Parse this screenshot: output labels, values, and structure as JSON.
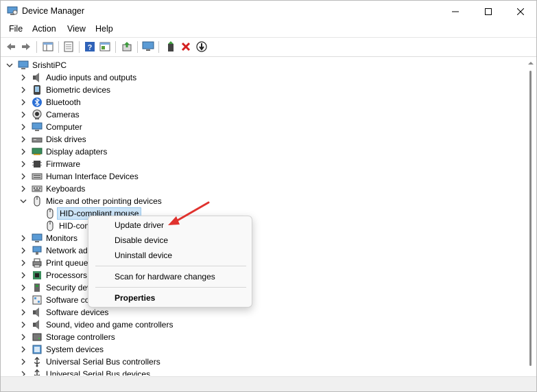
{
  "window": {
    "title": "Device Manager"
  },
  "menu": [
    "File",
    "Action",
    "View",
    "Help"
  ],
  "tree": {
    "root": "SrishtiPC",
    "categories": [
      {
        "label": "Audio inputs and outputs",
        "icon": "speaker-icon"
      },
      {
        "label": "Biometric devices",
        "icon": "fingerprint-icon"
      },
      {
        "label": "Bluetooth",
        "icon": "bluetooth-icon"
      },
      {
        "label": "Cameras",
        "icon": "camera-icon"
      },
      {
        "label": "Computer",
        "icon": "monitor-icon"
      },
      {
        "label": "Disk drives",
        "icon": "disk-drive-icon"
      },
      {
        "label": "Display adapters",
        "icon": "display-adapter-icon"
      },
      {
        "label": "Firmware",
        "icon": "chip-icon"
      },
      {
        "label": "Human Interface Devices",
        "icon": "hid-icon"
      },
      {
        "label": "Keyboards",
        "icon": "keyboard-icon"
      },
      {
        "label": "Mice and other pointing devices",
        "icon": "mouse-icon",
        "expanded": true,
        "children": [
          "HID-compliant mouse",
          "HID-con"
        ]
      },
      {
        "label": "Monitors",
        "icon": "monitor-icon"
      },
      {
        "label": "Network ad",
        "icon": "network-icon"
      },
      {
        "label": "Print queue",
        "icon": "printer-icon"
      },
      {
        "label": "Processors",
        "icon": "processor-icon"
      },
      {
        "label": "Security dev",
        "icon": "security-icon"
      },
      {
        "label": "Software co",
        "icon": "software-component-icon"
      },
      {
        "label": "Software devices",
        "icon": "speaker-icon"
      },
      {
        "label": "Sound, video and game controllers",
        "icon": "speaker-icon"
      },
      {
        "label": "Storage controllers",
        "icon": "storage-icon"
      },
      {
        "label": "System devices",
        "icon": "system-icon"
      },
      {
        "label": "Universal Serial Bus controllers",
        "icon": "usb-icon"
      },
      {
        "label": "Universal Serial Bus devices",
        "icon": "usb-icon"
      }
    ]
  },
  "context_menu": {
    "update": "Update driver",
    "disable": "Disable device",
    "uninstall": "Uninstall device",
    "scan": "Scan for hardware changes",
    "properties": "Properties"
  },
  "colors": {
    "selection": "#cce4f7",
    "annotation_arrow": "#e0322e"
  }
}
